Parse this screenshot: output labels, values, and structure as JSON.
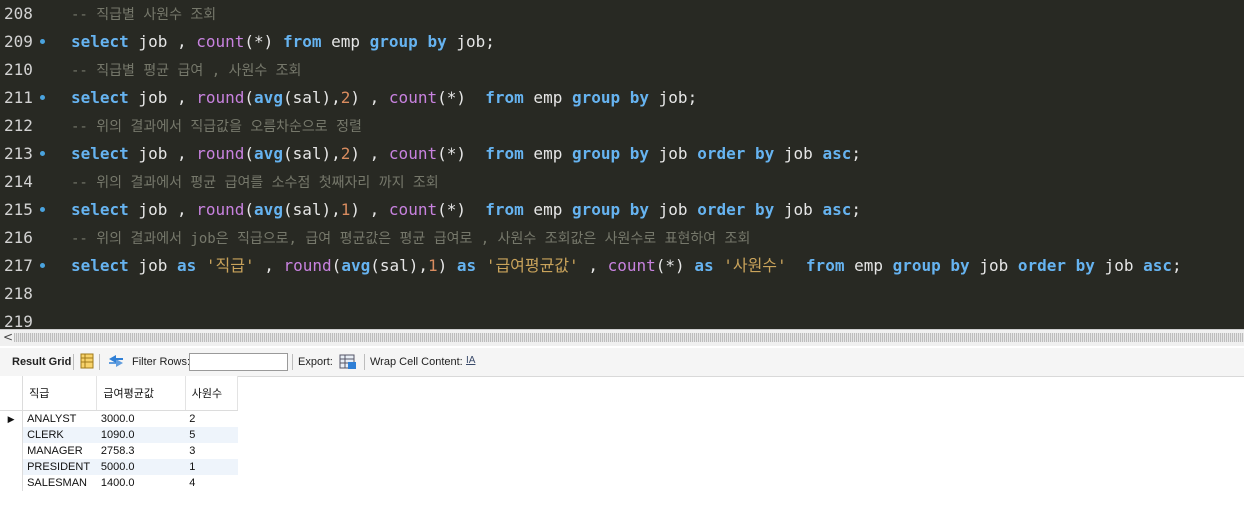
{
  "editor": {
    "lines": [
      {
        "num": "208",
        "marker": false,
        "tokens": [
          [
            "cm",
            "-- 직급별 사원수 조회"
          ]
        ]
      },
      {
        "num": "209",
        "marker": true,
        "tokens": [
          [
            "kw",
            "select"
          ],
          [
            "pl",
            " job , "
          ],
          [
            "fn",
            "count"
          ],
          [
            "pl",
            "(*) "
          ],
          [
            "kw",
            "from"
          ],
          [
            "pl",
            " emp "
          ],
          [
            "kw",
            "group by"
          ],
          [
            "pl",
            " job;"
          ]
        ]
      },
      {
        "num": "210",
        "marker": false,
        "tokens": [
          [
            "cm",
            "-- 직급별 평균 급여 , 사원수 조회"
          ]
        ]
      },
      {
        "num": "211",
        "marker": true,
        "tokens": [
          [
            "kw",
            "select"
          ],
          [
            "pl",
            " job , "
          ],
          [
            "fn",
            "round"
          ],
          [
            "pl",
            "("
          ],
          [
            "kw",
            "avg"
          ],
          [
            "pl",
            "(sal),"
          ],
          [
            "num",
            "2"
          ],
          [
            "pl",
            ") , "
          ],
          [
            "fn",
            "count"
          ],
          [
            "pl",
            "(*)  "
          ],
          [
            "kw",
            "from"
          ],
          [
            "pl",
            " emp "
          ],
          [
            "kw",
            "group by"
          ],
          [
            "pl",
            " job;"
          ]
        ]
      },
      {
        "num": "212",
        "marker": false,
        "tokens": [
          [
            "cm",
            "-- 위의 결과에서 직급값을 오름차순으로 정렬"
          ]
        ]
      },
      {
        "num": "213",
        "marker": true,
        "tokens": [
          [
            "kw",
            "select"
          ],
          [
            "pl",
            " job , "
          ],
          [
            "fn",
            "round"
          ],
          [
            "pl",
            "("
          ],
          [
            "kw",
            "avg"
          ],
          [
            "pl",
            "(sal),"
          ],
          [
            "num",
            "2"
          ],
          [
            "pl",
            ") , "
          ],
          [
            "fn",
            "count"
          ],
          [
            "pl",
            "(*)  "
          ],
          [
            "kw",
            "from"
          ],
          [
            "pl",
            " emp "
          ],
          [
            "kw",
            "group by"
          ],
          [
            "pl",
            " job "
          ],
          [
            "kw",
            "order by"
          ],
          [
            "pl",
            " job "
          ],
          [
            "kw",
            "asc"
          ],
          [
            "pl",
            ";"
          ]
        ]
      },
      {
        "num": "214",
        "marker": false,
        "tokens": [
          [
            "cm",
            "-- 위의 결과에서 평균 급여를 소수점 첫째자리 까지 조회"
          ]
        ]
      },
      {
        "num": "215",
        "marker": true,
        "tokens": [
          [
            "kw",
            "select"
          ],
          [
            "pl",
            " job , "
          ],
          [
            "fn",
            "round"
          ],
          [
            "pl",
            "("
          ],
          [
            "kw",
            "avg"
          ],
          [
            "pl",
            "(sal),"
          ],
          [
            "num",
            "1"
          ],
          [
            "pl",
            ") , "
          ],
          [
            "fn",
            "count"
          ],
          [
            "pl",
            "(*)  "
          ],
          [
            "kw",
            "from"
          ],
          [
            "pl",
            " emp "
          ],
          [
            "kw",
            "group by"
          ],
          [
            "pl",
            " job "
          ],
          [
            "kw",
            "order by"
          ],
          [
            "pl",
            " job "
          ],
          [
            "kw",
            "asc"
          ],
          [
            "pl",
            ";"
          ]
        ]
      },
      {
        "num": "216",
        "marker": false,
        "tokens": [
          [
            "cm",
            "-- 위의 결과에서 job은 직급으로, 급여 평균값은 평균 급여로 , 사원수 조회값은 사원수로 표현하여 조회"
          ]
        ]
      },
      {
        "num": "217",
        "marker": true,
        "tokens": [
          [
            "kw",
            "select"
          ],
          [
            "pl",
            " job "
          ],
          [
            "kw",
            "as"
          ],
          [
            "pl",
            " "
          ],
          [
            "str",
            "'직급'"
          ],
          [
            "pl",
            " , "
          ],
          [
            "fn",
            "round"
          ],
          [
            "pl",
            "("
          ],
          [
            "kw",
            "avg"
          ],
          [
            "pl",
            "(sal),"
          ],
          [
            "num",
            "1"
          ],
          [
            "pl",
            ") "
          ],
          [
            "kw",
            "as"
          ],
          [
            "pl",
            " "
          ],
          [
            "str",
            "'급여평균값'"
          ],
          [
            "pl",
            " , "
          ],
          [
            "fn",
            "count"
          ],
          [
            "pl",
            "(*) "
          ],
          [
            "kw",
            "as"
          ],
          [
            "pl",
            " "
          ],
          [
            "str",
            "'사원수'"
          ],
          [
            "pl",
            "  "
          ],
          [
            "kw",
            "from"
          ],
          [
            "pl",
            " emp "
          ],
          [
            "kw",
            "group by"
          ],
          [
            "pl",
            " job "
          ],
          [
            "kw",
            "order by"
          ],
          [
            "pl",
            " job "
          ],
          [
            "kw",
            "asc"
          ],
          [
            "pl",
            ";"
          ]
        ]
      },
      {
        "num": "218",
        "marker": false,
        "tokens": []
      },
      {
        "num": "219",
        "marker": false,
        "tokens": []
      }
    ]
  },
  "toolbar": {
    "result_grid_label": "Result Grid",
    "filter_rows_label": "Filter Rows:",
    "filter_value": "",
    "export_label": "Export:",
    "wrap_label": "Wrap Cell Content:",
    "wrap_icon_glyph": "IA"
  },
  "grid": {
    "columns": [
      "직급",
      "급여평균값",
      "사원수"
    ],
    "rows": [
      [
        "ANALYST",
        "3000.0",
        "2"
      ],
      [
        "CLERK",
        "1090.0",
        "5"
      ],
      [
        "MANAGER",
        "2758.3",
        "3"
      ],
      [
        "PRESIDENT",
        "5000.0",
        "1"
      ],
      [
        "SALESMAN",
        "1400.0",
        "4"
      ]
    ],
    "current_row_marker": "▶"
  }
}
